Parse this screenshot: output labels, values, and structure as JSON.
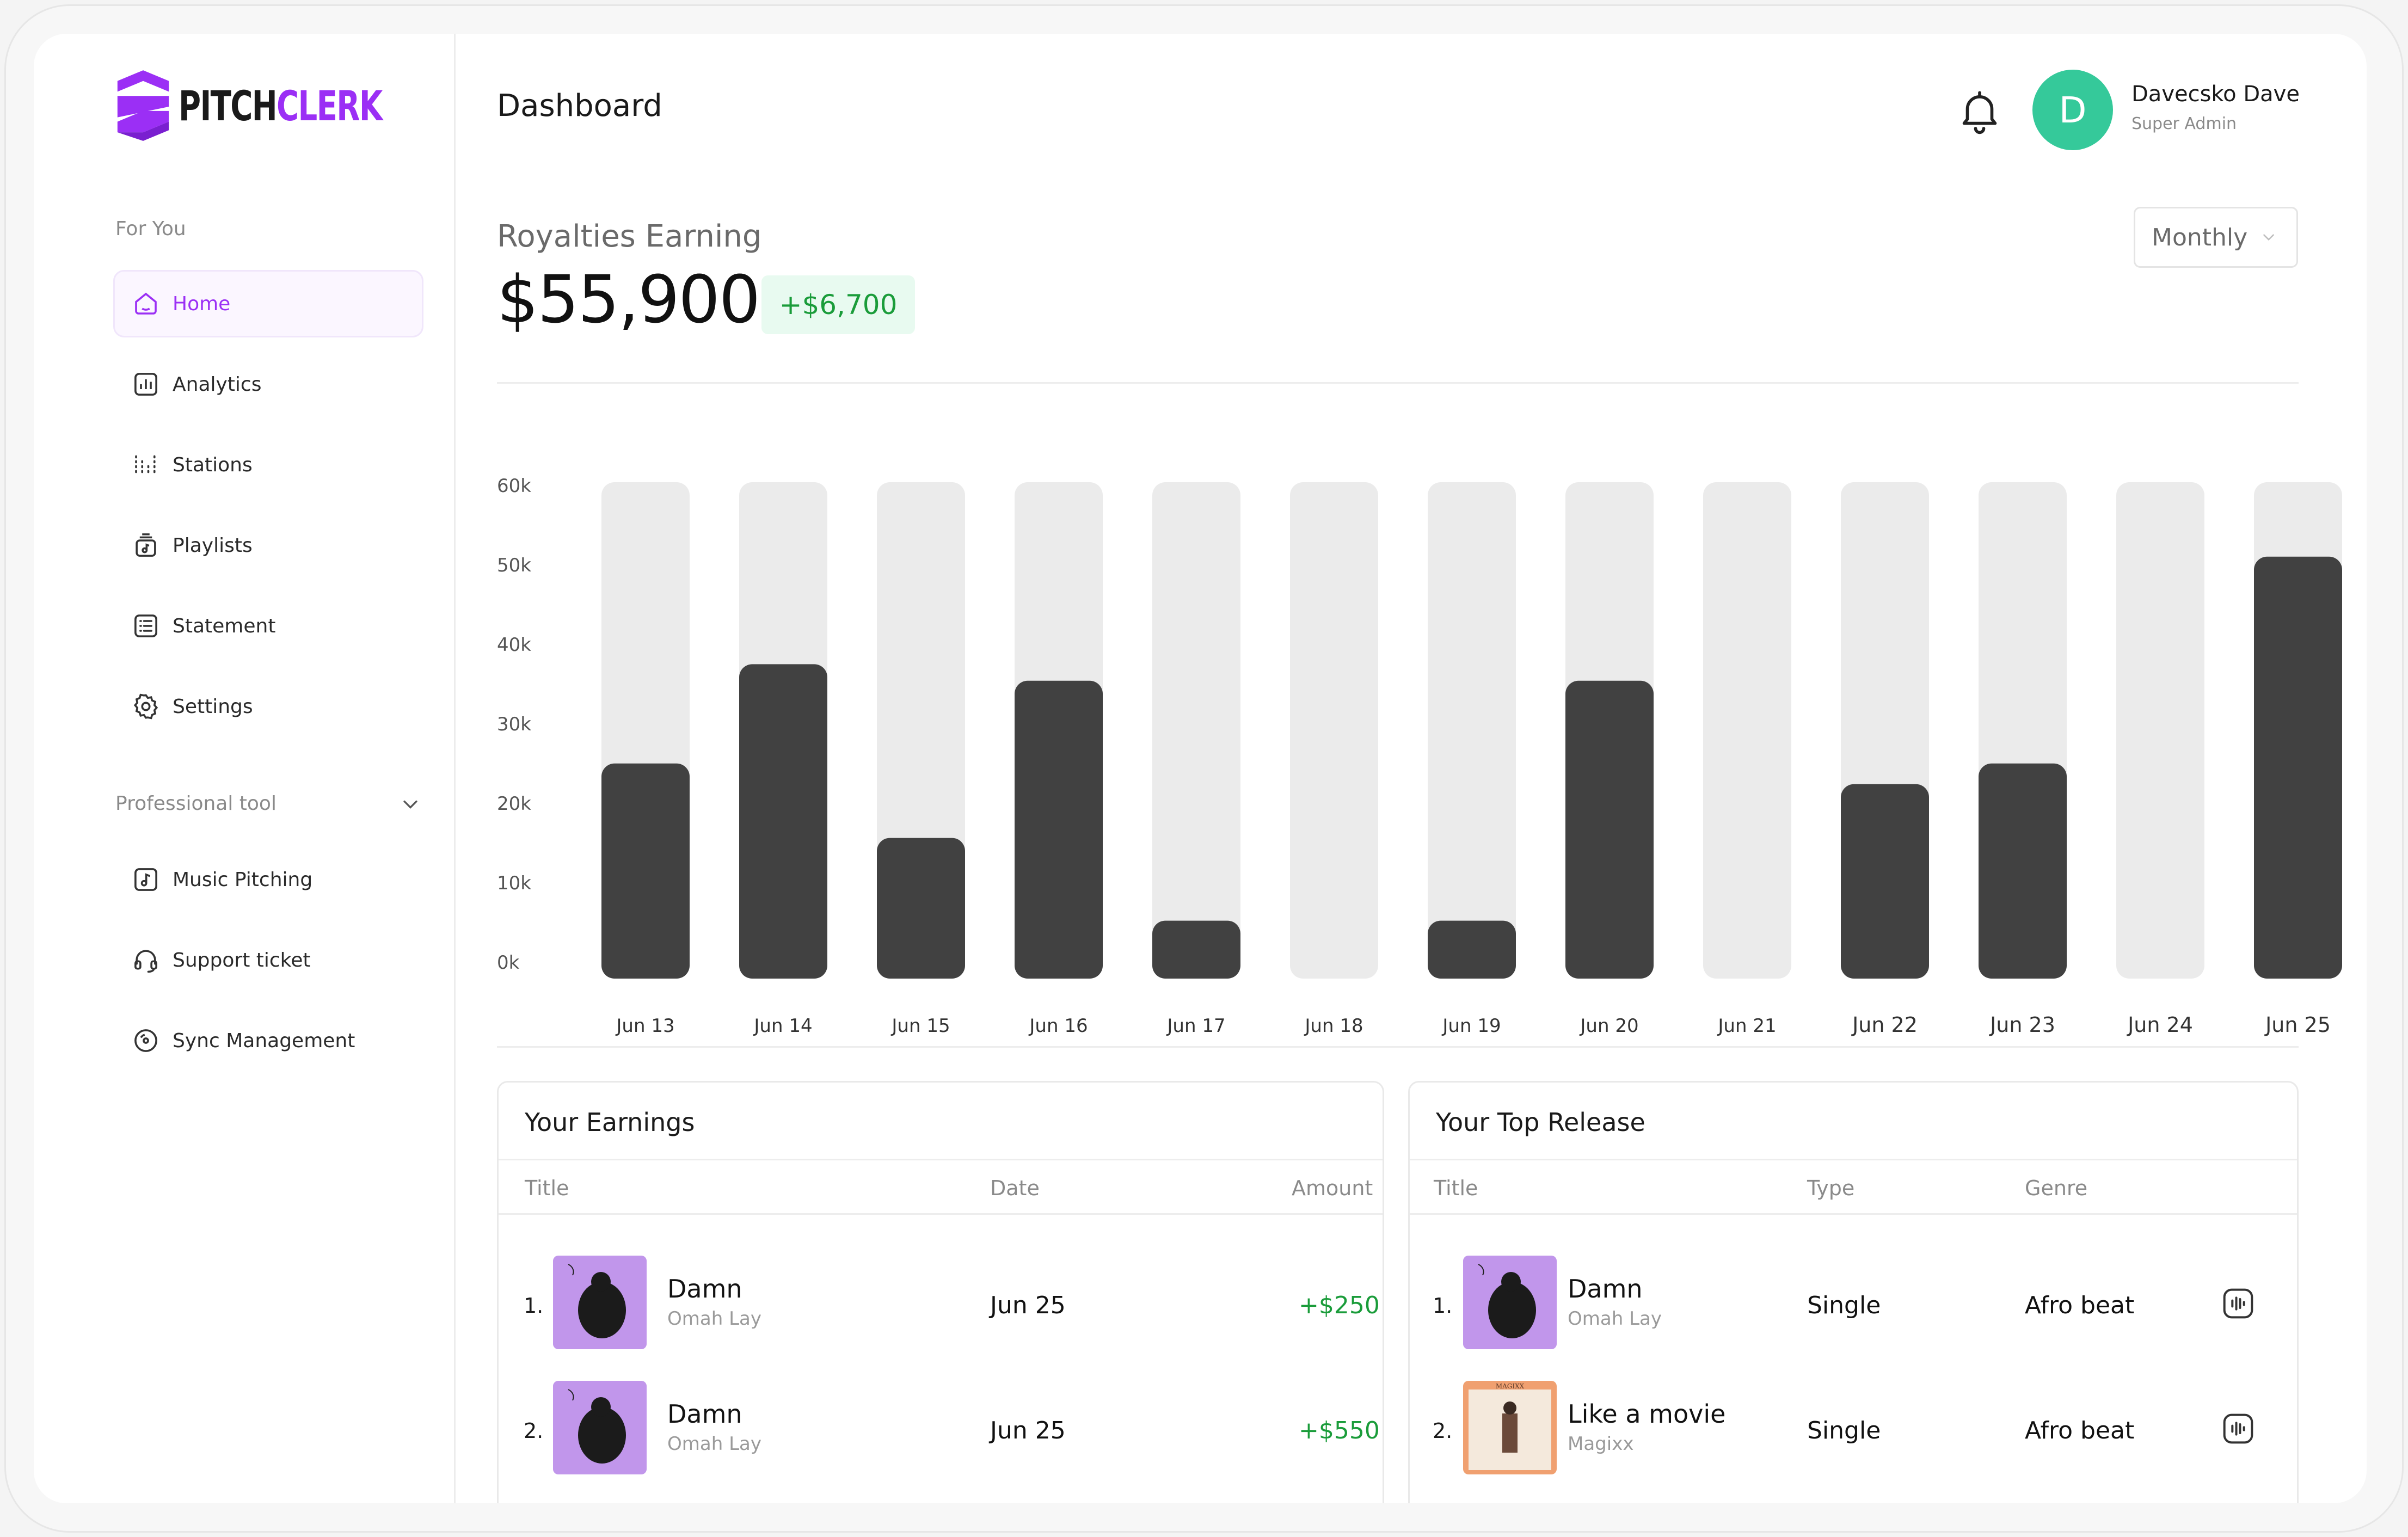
{
  "brand": {
    "name_part1": "PITCH",
    "name_part2": "CLERK",
    "accent": "#9b2ff5"
  },
  "sidebar": {
    "section1_label": "For You",
    "items": [
      {
        "label": "Home",
        "icon": "home-icon",
        "active": true
      },
      {
        "label": "Analytics",
        "icon": "analytics-icon"
      },
      {
        "label": "Stations",
        "icon": "stations-icon"
      },
      {
        "label": "Playlists",
        "icon": "playlists-icon"
      },
      {
        "label": "Statement",
        "icon": "statement-icon"
      },
      {
        "label": "Settings",
        "icon": "settings-icon"
      }
    ],
    "section2_label": "Professional tool",
    "tools": [
      {
        "label": "Music Pitching",
        "icon": "music-note-icon"
      },
      {
        "label": "Support ticket",
        "icon": "headset-icon"
      },
      {
        "label": "Sync Management",
        "icon": "disc-icon"
      }
    ]
  },
  "header": {
    "title": "Dashboard",
    "user": {
      "initial": "D",
      "name": "Davecsko Dave",
      "role": "Super Admin",
      "avatar_color": "#35c99a"
    }
  },
  "royalties": {
    "label": "Royalties Earning",
    "amount": "$55,900",
    "delta": "+$6,700",
    "period": "Monthly"
  },
  "chart_data": {
    "type": "bar",
    "categories": [
      "Jun 13",
      "Jun 14",
      "Jun 15",
      "Jun 16",
      "Jun 17",
      "Jun 18",
      "Jun 19",
      "Jun 20",
      "Jun 21",
      "Jun 22",
      "Jun 23",
      "Jun 24",
      "Jun 25"
    ],
    "values": [
      26000,
      38000,
      17000,
      36000,
      7000,
      0,
      7000,
      36000,
      0,
      23500,
      26000,
      0,
      51000
    ],
    "y_ticks": [
      "60k",
      "50k",
      "40k",
      "30k",
      "20k",
      "10k",
      "0k"
    ],
    "ylim": [
      0,
      60000
    ],
    "bar_color": "#414141",
    "track_color": "#ebebeb"
  },
  "earnings": {
    "title": "Your Earnings",
    "columns": [
      "Title",
      "Date",
      "Amount"
    ],
    "rows": [
      {
        "num": "1.",
        "title": "Damn",
        "artist": "Omah Lay",
        "date": "Jun 25",
        "amount": "+$250"
      },
      {
        "num": "2.",
        "title": "Damn",
        "artist": "Omah Lay",
        "date": "Jun 25",
        "amount": "+$550"
      }
    ]
  },
  "top_release": {
    "title": "Your Top Release",
    "columns": [
      "Title",
      "Type",
      "Genre"
    ],
    "rows": [
      {
        "num": "1.",
        "title": "Damn",
        "artist": "Omah Lay",
        "type": "Single",
        "genre": "Afro beat"
      },
      {
        "num": "2.",
        "title": "Like a movie",
        "artist": "Magixx",
        "type": "Single",
        "genre": "Afro beat",
        "cover_text": "MAGIXX"
      }
    ]
  }
}
